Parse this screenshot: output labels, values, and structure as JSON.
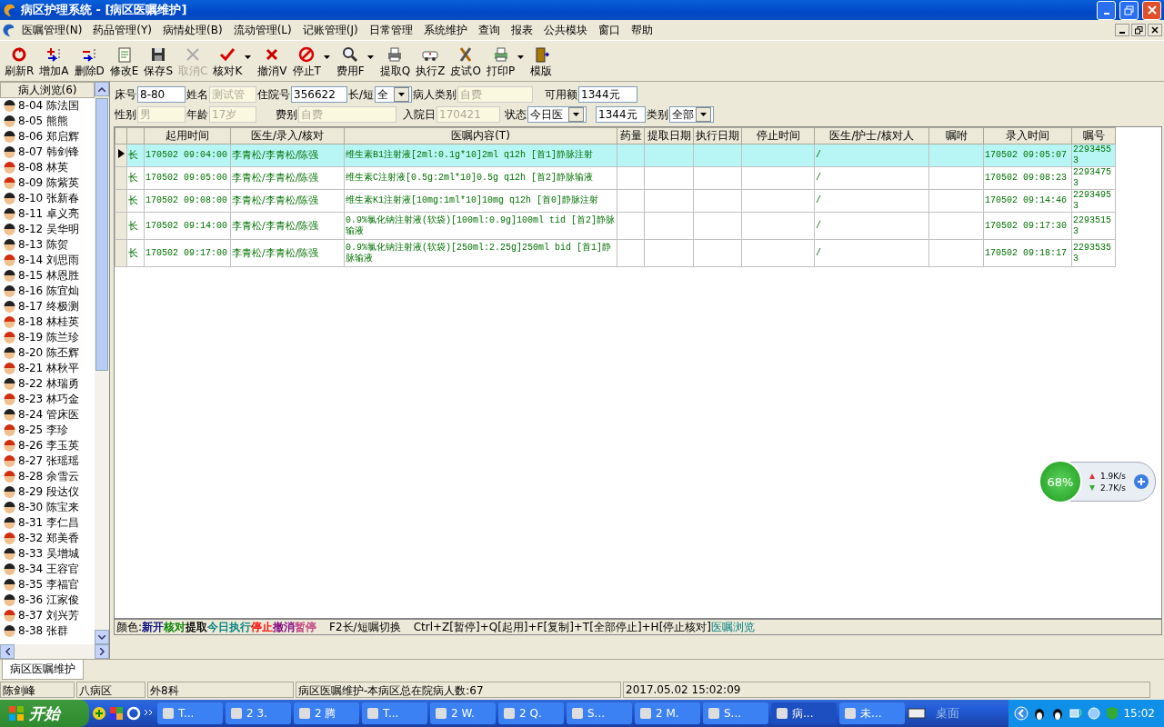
{
  "window": {
    "title": "病区护理系统 - [病区医嘱维护]"
  },
  "menu": [
    "医嘱管理(N)",
    "药品管理(Y)",
    "病情处理(B)",
    "流动管理(L)",
    "记账管理(J)",
    "日常管理",
    "系统维护",
    "查询",
    "报表",
    "公共模块",
    "窗口",
    "帮助"
  ],
  "toolbar": [
    {
      "label": "刷新R",
      "disabled": false,
      "dropdown": false
    },
    {
      "label": "增加A",
      "disabled": false,
      "dropdown": false
    },
    {
      "label": "删除D",
      "disabled": false,
      "dropdown": false
    },
    {
      "label": "修改E",
      "disabled": false,
      "dropdown": false
    },
    {
      "label": "保存S",
      "disabled": false,
      "dropdown": false
    },
    {
      "label": "取消C",
      "disabled": true,
      "dropdown": false
    },
    {
      "label": "核对K",
      "disabled": false,
      "dropdown": true
    },
    {
      "label": "撤消V",
      "disabled": false,
      "dropdown": false
    },
    {
      "label": "停止T",
      "disabled": false,
      "dropdown": true
    },
    {
      "label": "费用F",
      "disabled": false,
      "dropdown": true
    },
    {
      "label": "提取Q",
      "disabled": false,
      "dropdown": false
    },
    {
      "label": "执行Z",
      "disabled": false,
      "dropdown": false
    },
    {
      "label": "皮试O",
      "disabled": false,
      "dropdown": false
    },
    {
      "label": "打印P",
      "disabled": false,
      "dropdown": true
    },
    {
      "label": "模版",
      "disabled": false,
      "dropdown": false
    }
  ],
  "sidebar": {
    "title": "病人浏览(6)",
    "patients": [
      {
        "bed": "8-04",
        "name": "陈法国",
        "kind": "male"
      },
      {
        "bed": "8-05",
        "name": "熊熊",
        "kind": "male"
      },
      {
        "bed": "8-06",
        "name": "郑启辉",
        "kind": "male"
      },
      {
        "bed": "8-07",
        "name": "韩剑锋",
        "kind": "male"
      },
      {
        "bed": "8-08",
        "name": "林英",
        "kind": "female"
      },
      {
        "bed": "8-09",
        "name": "陈紫英",
        "kind": "female"
      },
      {
        "bed": "8-10",
        "name": "张新春",
        "kind": "male"
      },
      {
        "bed": "8-11",
        "name": "卓义亮",
        "kind": "male"
      },
      {
        "bed": "8-12",
        "name": "吴华明",
        "kind": "male"
      },
      {
        "bed": "8-13",
        "name": "陈贺",
        "kind": "male"
      },
      {
        "bed": "8-14",
        "name": "刘思雨",
        "kind": "female"
      },
      {
        "bed": "8-15",
        "name": "林恩胜",
        "kind": "male"
      },
      {
        "bed": "8-16",
        "name": "陈宜灿",
        "kind": "male"
      },
      {
        "bed": "8-17",
        "name": "终极测",
        "kind": "male"
      },
      {
        "bed": "8-18",
        "name": "林桂英",
        "kind": "female"
      },
      {
        "bed": "8-19",
        "name": "陈兰珍",
        "kind": "female"
      },
      {
        "bed": "8-20",
        "name": "陈丕辉",
        "kind": "male"
      },
      {
        "bed": "8-21",
        "name": "林秋平",
        "kind": "female"
      },
      {
        "bed": "8-22",
        "name": "林瑞勇",
        "kind": "male"
      },
      {
        "bed": "8-23",
        "name": "林巧金",
        "kind": "female"
      },
      {
        "bed": "8-24",
        "name": "管床医",
        "kind": "male"
      },
      {
        "bed": "8-25",
        "name": "李珍",
        "kind": "female"
      },
      {
        "bed": "8-26",
        "name": "李玉英",
        "kind": "female"
      },
      {
        "bed": "8-27",
        "name": "张瑶瑶",
        "kind": "female"
      },
      {
        "bed": "8-28",
        "name": "余雪云",
        "kind": "female"
      },
      {
        "bed": "8-29",
        "name": "段达仪",
        "kind": "male"
      },
      {
        "bed": "8-30",
        "name": "陈宝来",
        "kind": "male"
      },
      {
        "bed": "8-31",
        "name": "李仁昌",
        "kind": "male"
      },
      {
        "bed": "8-32",
        "name": "郑美香",
        "kind": "female"
      },
      {
        "bed": "8-33",
        "name": "吴增城",
        "kind": "male"
      },
      {
        "bed": "8-34",
        "name": "王容官",
        "kind": "male"
      },
      {
        "bed": "8-35",
        "name": "李福官",
        "kind": "male"
      },
      {
        "bed": "8-36",
        "name": "江家俊",
        "kind": "male"
      },
      {
        "bed": "8-37",
        "name": "刘兴芳",
        "kind": "female"
      },
      {
        "bed": "8-38",
        "name": "张群",
        "kind": "male"
      }
    ]
  },
  "form": {
    "fields": [
      {
        "label": "床号",
        "value": "8-80",
        "kind": "text",
        "disabled": false
      },
      {
        "label": "姓名",
        "value": "测试管",
        "kind": "text",
        "disabled": true
      },
      {
        "label": "住院号",
        "value": "356622",
        "kind": "text",
        "disabled": false
      },
      {
        "label": "长/短",
        "value": "全",
        "kind": "select",
        "disabled": false
      },
      {
        "label": "病人类别",
        "value": "自费",
        "kind": "text",
        "disabled": true
      },
      {
        "label": "可用额",
        "value": "1344元",
        "kind": "text",
        "disabled": false
      },
      {
        "label": "性别",
        "value": "男",
        "kind": "text",
        "disabled": true
      },
      {
        "label": "年龄",
        "value": "17岁",
        "kind": "text",
        "disabled": true
      },
      {
        "label": "费别",
        "value": "自费",
        "kind": "text",
        "disabled": true
      },
      {
        "label": "入院日",
        "value": "170421",
        "kind": "text",
        "disabled": true
      },
      {
        "label": "状态",
        "value": "今日医",
        "kind": "select",
        "disabled": false
      },
      {
        "value": "1344元",
        "kind": "text",
        "disabled": false
      },
      {
        "label": "类别",
        "value": "全部",
        "kind": "select",
        "disabled": false
      }
    ]
  },
  "table": {
    "columns": [
      "起用时间",
      "医生/录入/核对",
      "医嘱内容(T)",
      "药量",
      "提取日期",
      "执行日期",
      "停止时间",
      "医生/护士/核对人",
      "嘱咐",
      "录入时间",
      "嘱号"
    ],
    "rows": [
      {
        "selected": true,
        "type": "长",
        "start": "170502 09:04:00",
        "doctor": "李青松/李青松/陈强",
        "content": "维生素B1注射液[2ml:0.1g*10]2ml q12h [首1]静脉注射",
        "nurse": "/",
        "entered": "170502 09:05:07",
        "number": "22934553"
      },
      {
        "selected": false,
        "type": "长",
        "start": "170502 09:05:00",
        "doctor": "李青松/李青松/陈强",
        "content": "维生素C注射液[0.5g:2ml*10]0.5g q12h [首2]静脉输液",
        "nurse": "/",
        "entered": "170502 09:08:23",
        "number": "22934753"
      },
      {
        "selected": false,
        "type": "长",
        "start": "170502 09:08:00",
        "doctor": "李青松/李青松/陈强",
        "content": "维生素K1注射液[10mg:1ml*10]10mg q12h [首0]静脉注射",
        "nurse": "/",
        "entered": "170502 09:14:46",
        "number": "22934953"
      },
      {
        "selected": false,
        "type": "长",
        "start": "170502 09:14:00",
        "doctor": "李青松/李青松/陈强",
        "content": "0.9%氯化钠注射液(软袋)[100ml:0.9g]100ml tid [首2]静脉输液",
        "nurse": "/",
        "entered": "170502 09:17:30",
        "number": "22935153"
      },
      {
        "selected": false,
        "type": "长",
        "start": "170502 09:17:00",
        "doctor": "李青松/李青松/陈强",
        "content": "0.9%氯化钠注射液(软袋)[250ml:2.25g]250ml bid [首1]静脉输液",
        "nurse": "/",
        "entered": "170502 09:18:17",
        "number": "22935353"
      }
    ]
  },
  "legend": {
    "label": "颜色:",
    "items": [
      {
        "text": "新开",
        "color": "#000080"
      },
      {
        "text": "核对",
        "color": "#008000"
      },
      {
        "text": "提取",
        "color": "#000000"
      },
      {
        "text": "今日执行",
        "color": "#008080"
      },
      {
        "text": "停止",
        "color": "#ff0000"
      },
      {
        "text": "撤消",
        "color": "#800080"
      },
      {
        "text": "暂停",
        "color": "#c04080"
      }
    ],
    "hints": [
      "F2长/短嘱切换",
      "Ctrl+Z[暂停]+Q[起用]+F[复制]+T[全部停止]+H[停止核对]"
    ],
    "link": "医嘱浏览"
  },
  "bottom_tab": "病区医嘱维护",
  "status_bar": [
    "陈剑峰",
    "八病区",
    "外8科",
    "病区医嘱维护-本病区总在院病人数:67",
    "2017.05.02 15:02:09"
  ],
  "net_widget": {
    "percent": "68%",
    "up": "1.9K/s",
    "down": "2.7K/s"
  },
  "taskbar": {
    "start": "开始",
    "tasks": [
      {
        "label": "T...",
        "selected": false
      },
      {
        "label": "2 3.",
        "selected": false
      },
      {
        "label": "2 腾",
        "selected": false
      },
      {
        "label": "T...",
        "selected": false
      },
      {
        "label": "2 W.",
        "selected": false
      },
      {
        "label": "2 Q.",
        "selected": false
      },
      {
        "label": "S...",
        "selected": false
      },
      {
        "label": "2 M.",
        "selected": false
      },
      {
        "label": "S...",
        "selected": false
      },
      {
        "label": "病...",
        "selected": true
      },
      {
        "label": "未...",
        "selected": false
      }
    ],
    "desktop": "桌面",
    "clock": "15:02"
  }
}
